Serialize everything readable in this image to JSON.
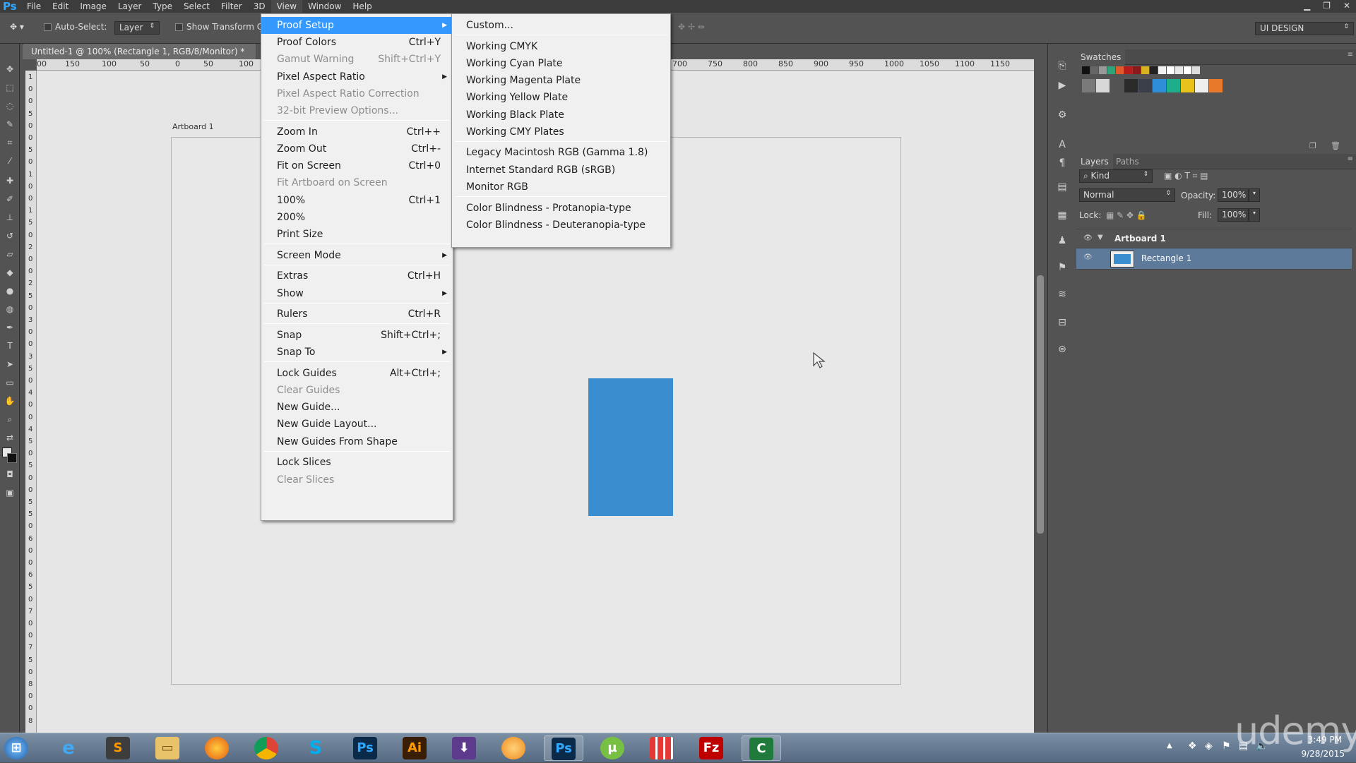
{
  "menubar": {
    "logo": "Ps",
    "items": [
      "File",
      "Edit",
      "Image",
      "Layer",
      "Type",
      "Select",
      "Filter",
      "3D",
      "View",
      "Window",
      "Help"
    ]
  },
  "options_bar": {
    "auto_select_label": "Auto-Select:",
    "auto_select_value": "Layer",
    "show_transform_label": "Show Transform C",
    "workspace": "UI DESIGN"
  },
  "document": {
    "tab_title": "Untitled-1 @ 100% (Rectangle 1, RGB/8/Monitor) *",
    "artboard_label": "Artboard 1",
    "ruler_h_left": [
      "00",
      "150",
      "100",
      "50",
      "0",
      "50",
      "100"
    ],
    "ruler_h_right": [
      "700",
      "750",
      "800",
      "850",
      "900",
      "950",
      "1000",
      "1050",
      "1100",
      "1150"
    ],
    "ruler_v": [
      "1",
      "0",
      "0",
      "5",
      "0",
      "0",
      "5",
      "0",
      "1",
      "0",
      "0",
      "1",
      "5",
      "0",
      "2",
      "0",
      "0",
      "2",
      "5",
      "0",
      "3",
      "0",
      "0",
      "3",
      "5",
      "0",
      "4",
      "0",
      "0",
      "4",
      "5",
      "0",
      "5",
      "0",
      "0",
      "5",
      "5",
      "0",
      "6",
      "0",
      "0",
      "6",
      "5",
      "0",
      "7",
      "0",
      "0",
      "7",
      "5",
      "0",
      "8",
      "0",
      "0",
      "8"
    ]
  },
  "view_menu": {
    "items": [
      {
        "label": "Proof Setup",
        "shortcut": "",
        "submenu": true,
        "state": "highlight"
      },
      {
        "label": "Proof Colors",
        "shortcut": "Ctrl+Y"
      },
      {
        "label": "Gamut Warning",
        "shortcut": "Shift+Ctrl+Y",
        "state": "disabled"
      },
      {
        "label": "Pixel Aspect Ratio",
        "shortcut": "",
        "submenu": true
      },
      {
        "label": "Pixel Aspect Ratio Correction",
        "shortcut": "",
        "state": "disabled"
      },
      {
        "label": "32-bit Preview Options...",
        "shortcut": "",
        "state": "disabled"
      },
      {
        "label": "Zoom In",
        "shortcut": "Ctrl++"
      },
      {
        "label": "Zoom Out",
        "shortcut": "Ctrl+-"
      },
      {
        "label": "Fit on Screen",
        "shortcut": "Ctrl+0"
      },
      {
        "label": "Fit Artboard on Screen",
        "shortcut": "",
        "state": "disabled"
      },
      {
        "label": "100%",
        "shortcut": "Ctrl+1"
      },
      {
        "label": "200%",
        "shortcut": ""
      },
      {
        "label": "Print Size",
        "shortcut": ""
      },
      {
        "label": "Screen Mode",
        "shortcut": "",
        "submenu": true
      },
      {
        "label": "Extras",
        "shortcut": "Ctrl+H"
      },
      {
        "label": "Show",
        "shortcut": "",
        "submenu": true
      },
      {
        "label": "Rulers",
        "shortcut": "Ctrl+R"
      },
      {
        "label": "Snap",
        "shortcut": "Shift+Ctrl+;"
      },
      {
        "label": "Snap To",
        "shortcut": "",
        "submenu": true
      },
      {
        "label": "Lock Guides",
        "shortcut": "Alt+Ctrl+;"
      },
      {
        "label": "Clear Guides",
        "shortcut": "",
        "state": "disabled"
      },
      {
        "label": "New Guide...",
        "shortcut": ""
      },
      {
        "label": "New Guide Layout...",
        "shortcut": ""
      },
      {
        "label": "New Guides From Shape",
        "shortcut": ""
      },
      {
        "label": "Lock Slices",
        "shortcut": ""
      },
      {
        "label": "Clear Slices",
        "shortcut": "",
        "state": "disabled"
      }
    ]
  },
  "proof_setup_menu": {
    "items": [
      "Custom...",
      "Working CMYK",
      "Working Cyan Plate",
      "Working Magenta Plate",
      "Working Yellow Plate",
      "Working Black Plate",
      "Working CMY Plates",
      "Legacy Macintosh RGB (Gamma 1.8)",
      "Internet Standard RGB (sRGB)",
      "Monitor RGB",
      "Color Blindness - Protanopia-type",
      "Color Blindness - Deuteranopia-type"
    ]
  },
  "swatches_panel": {
    "title": "Swatches",
    "row1": [
      "#111111",
      "#666666",
      "#999999",
      "#2fa37a",
      "#e05a2b",
      "#b71c1c",
      "#8b1a1a",
      "#d9b21f",
      "#222222",
      "#f2f2f2",
      "#ffffff",
      "#e8e8e8",
      "#ffffff",
      "#dddddd"
    ],
    "row2": [
      "#7a7a7a",
      "#d8d8d8",
      "#535353",
      "#2a2a2a",
      "#3a3f4a",
      "#2e8fd8",
      "#1fae8c",
      "#e8c21a",
      "#efefef",
      "#e8792a"
    ]
  },
  "layers_panel": {
    "tabs": [
      "Layers",
      "Paths"
    ],
    "filter": "Kind",
    "blend_mode": "Normal",
    "opacity_label": "Opacity:",
    "opacity": "100%",
    "lock_label": "Lock:",
    "fill_label": "Fill:",
    "fill": "100%",
    "layers": [
      {
        "name": "Artboard 1",
        "type": "artboard"
      },
      {
        "name": "Rectangle 1",
        "type": "shape",
        "selected": true
      }
    ]
  },
  "taskbar": {
    "apps": [
      "start",
      "internet-explorer",
      "sublime",
      "file-explorer",
      "firefox",
      "chrome",
      "skype",
      "photoshop",
      "illustrator",
      "downloader",
      "orange-app",
      "photoshop-running",
      "utorrent",
      "metro",
      "filezilla",
      "camtasia"
    ],
    "time": "3:49 PM",
    "date": "9/28/2015"
  },
  "watermark": "udemy",
  "colors": {
    "menu_highlight": "#3399ff",
    "rectangle": "#3a8ed0",
    "layer_selected": "#5d7a9b"
  }
}
